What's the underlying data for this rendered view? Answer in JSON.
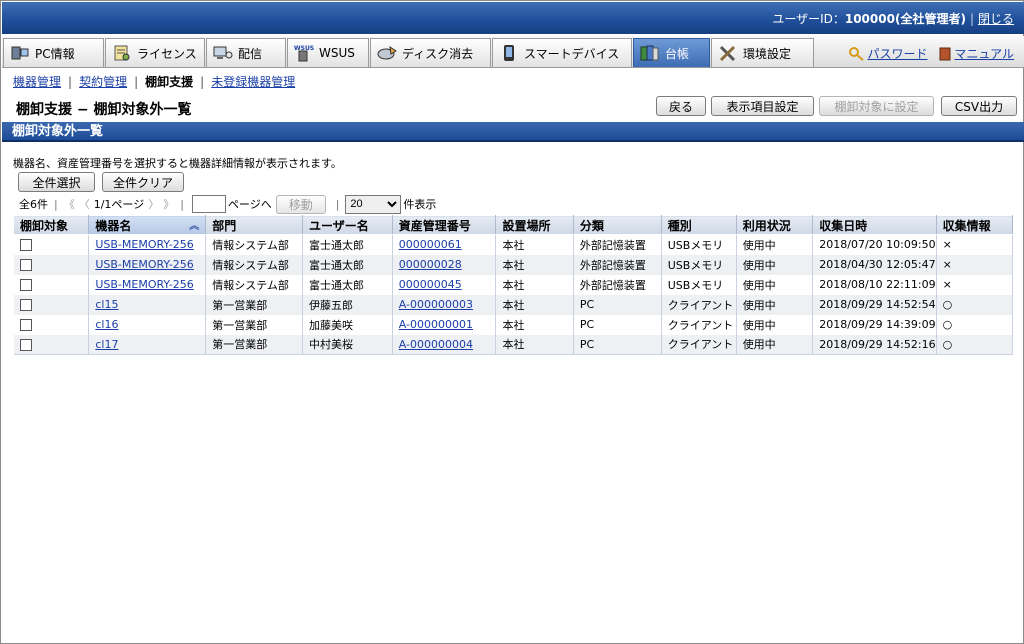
{
  "header": {
    "user_label": "ユーザーID：",
    "user_value": "100000(全社管理者)",
    "close_label": "閉じる"
  },
  "tabs": [
    {
      "label": "PC情報",
      "icon": "pc-info-icon"
    },
    {
      "label": "ライセンス",
      "icon": "license-icon"
    },
    {
      "label": "配信",
      "icon": "distribution-icon"
    },
    {
      "label": "WSUS",
      "icon": "wsus-icon"
    },
    {
      "label": "ディスク消去",
      "icon": "disk-erase-icon"
    },
    {
      "label": "スマートデバイス",
      "icon": "smart-device-icon"
    },
    {
      "label": "台帳",
      "icon": "ledger-icon"
    },
    {
      "label": "環境設定",
      "icon": "settings-icon"
    }
  ],
  "right_links": {
    "password": "パスワード",
    "manual": "マニュアル"
  },
  "subnav": {
    "items": [
      "機器管理",
      "契約管理",
      "棚卸支援",
      "未登録機器管理"
    ]
  },
  "page": {
    "title": "棚卸支援 − 棚卸対象外一覧",
    "buttons": {
      "back": "戻る",
      "display_items": "表示項目設定",
      "set_target": "棚卸対象に設定",
      "csv": "CSV出力"
    }
  },
  "section_title": "棚卸対象外一覧",
  "description": "機器名、資産管理番号を選択すると機器詳細情報が表示されます。",
  "select_buttons": {
    "select_all": "全件選択",
    "clear_all": "全件クリア"
  },
  "pager": {
    "total": "全6件",
    "first": "《",
    "prev": "〈",
    "page_info": "1/1ページ",
    "next": "〉",
    "last": "》",
    "goto_suffix": "ページへ",
    "move": "移動",
    "per_page": "20",
    "per_page_suffix": "件表示"
  },
  "table": {
    "columns": [
      "棚卸対象",
      "機器名",
      "部門",
      "ユーザー名",
      "資産管理番号",
      "設置場所",
      "分類",
      "種別",
      "利用状況",
      "収集日時",
      "収集情報"
    ],
    "rows": [
      {
        "device": "USB-MEMORY-256",
        "dept": "情報システム部",
        "user": "富士通太郎",
        "asset": "000000061",
        "location": "本社",
        "category": "外部記憶装置",
        "type": "USBメモリ",
        "status": "使用中",
        "collected": "2018/07/20 10:09:50",
        "info": "×"
      },
      {
        "device": "USB-MEMORY-256",
        "dept": "情報システム部",
        "user": "富士通太郎",
        "asset": "000000028",
        "location": "本社",
        "category": "外部記憶装置",
        "type": "USBメモリ",
        "status": "使用中",
        "collected": "2018/04/30 12:05:47",
        "info": "×"
      },
      {
        "device": "USB-MEMORY-256",
        "dept": "情報システム部",
        "user": "富士通太郎",
        "asset": "000000045",
        "location": "本社",
        "category": "外部記憶装置",
        "type": "USBメモリ",
        "status": "使用中",
        "collected": "2018/08/10 22:11:09",
        "info": "×"
      },
      {
        "device": "cl15",
        "dept": "第一営業部",
        "user": "伊藤五郎",
        "asset": "A-000000003",
        "location": "本社",
        "category": "PC",
        "type": "クライアント",
        "status": "使用中",
        "collected": "2018/09/29 14:52:54",
        "info": "○"
      },
      {
        "device": "cl16",
        "dept": "第一営業部",
        "user": "加藤美咲",
        "asset": "A-000000001",
        "location": "本社",
        "category": "PC",
        "type": "クライアント",
        "status": "使用中",
        "collected": "2018/09/29 14:39:09",
        "info": "○"
      },
      {
        "device": "cl17",
        "dept": "第一営業部",
        "user": "中村美桜",
        "asset": "A-000000004",
        "location": "本社",
        "category": "PC",
        "type": "クライアント",
        "status": "使用中",
        "collected": "2018/09/29 14:52:16",
        "info": "○"
      }
    ]
  },
  "colors": {
    "header_blue": "#1f4e99",
    "active_tab": "#3e6cb4",
    "link": "#1a3fa6"
  }
}
